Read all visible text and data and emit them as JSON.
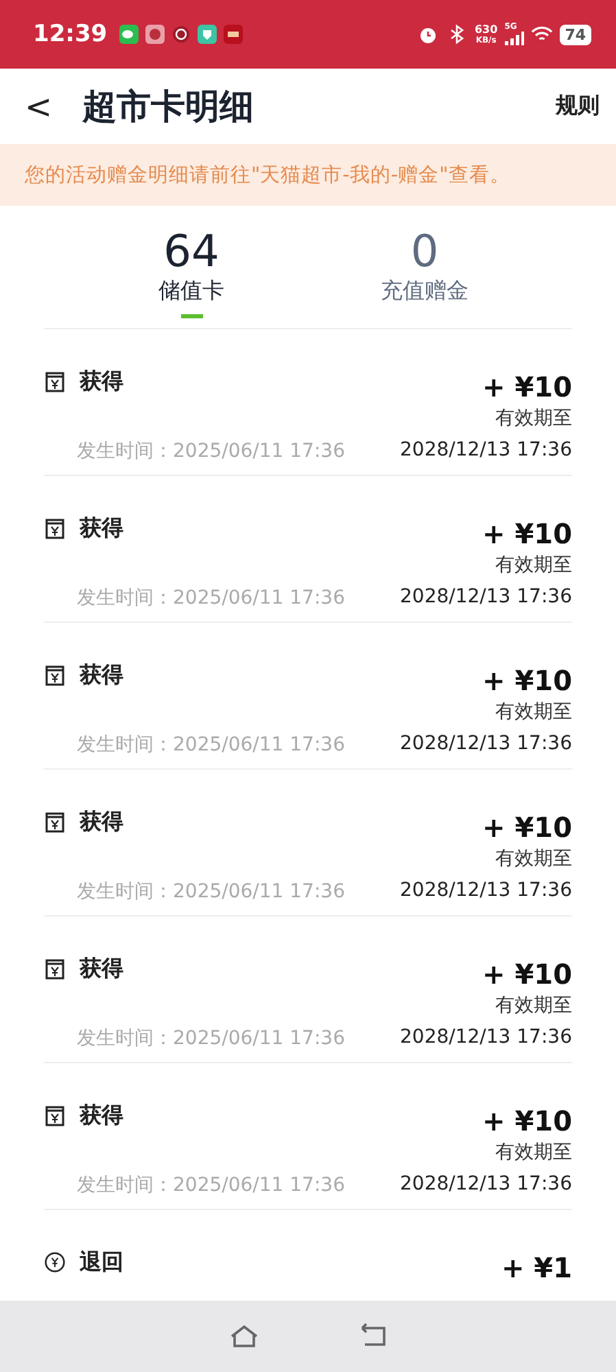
{
  "status_bar": {
    "time": "12:39",
    "net_speed": "630",
    "net_unit": "KB/s",
    "network": "5G",
    "battery": "74"
  },
  "header": {
    "back": "<",
    "title": "超市卡明细",
    "action": "规则"
  },
  "notice": "您的活动赠金明细请前往\"天猫超市-我的-赠金\"查看。",
  "tabs": [
    {
      "count": "64",
      "label": "储值卡",
      "selected": true
    },
    {
      "count": "0",
      "label": "充值赠金",
      "selected": false
    }
  ],
  "records": [
    {
      "kind": "card",
      "type": "获得",
      "amount": "+ ¥10",
      "expiry_label": "有效期至",
      "time": "发生时间：2025/06/11 17:36",
      "expiry": "2028/12/13 17:36"
    },
    {
      "kind": "card",
      "type": "获得",
      "amount": "+ ¥10",
      "expiry_label": "有效期至",
      "time": "发生时间：2025/06/11 17:36",
      "expiry": "2028/12/13 17:36"
    },
    {
      "kind": "card",
      "type": "获得",
      "amount": "+ ¥10",
      "expiry_label": "有效期至",
      "time": "发生时间：2025/06/11 17:36",
      "expiry": "2028/12/13 17:36"
    },
    {
      "kind": "card",
      "type": "获得",
      "amount": "+ ¥10",
      "expiry_label": "有效期至",
      "time": "发生时间：2025/06/11 17:36",
      "expiry": "2028/12/13 17:36"
    },
    {
      "kind": "card",
      "type": "获得",
      "amount": "+ ¥10",
      "expiry_label": "有效期至",
      "time": "发生时间：2025/06/11 17:36",
      "expiry": "2028/12/13 17:36"
    },
    {
      "kind": "card",
      "type": "获得",
      "amount": "+ ¥10",
      "expiry_label": "有效期至",
      "time": "发生时间：2025/06/11 17:36",
      "expiry": "2028/12/13 17:36"
    },
    {
      "kind": "refund",
      "type": "退回",
      "amount": "+ ¥1"
    }
  ]
}
